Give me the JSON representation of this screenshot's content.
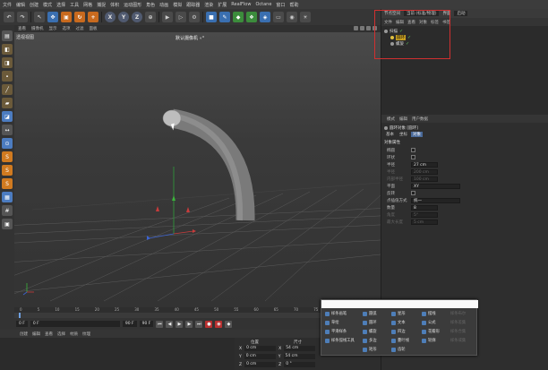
{
  "menubar": {
    "items": [
      "文件",
      "编辑",
      "创建",
      "模式",
      "选择",
      "工具",
      "网格",
      "捕捉",
      "体积",
      "运动图形",
      "角色",
      "动画",
      "模拟",
      "跟踪器",
      "渲染",
      "扩展",
      "RealFlow",
      "Octane",
      "窗口",
      "帮助"
    ],
    "interface_label": "界面",
    "interface_value": "启动",
    "node_space_label": "节点空间",
    "node_space_value": "当前 (标准/物理)"
  },
  "toolbar": {
    "icons": [
      "undo-icon",
      "redo-icon",
      "select-icon",
      "move-icon",
      "scale-icon",
      "rotate-icon",
      "add-icon",
      "x-axis-icon",
      "y-axis-icon",
      "z-axis-icon",
      "coord-icon",
      "render-view-icon",
      "render-icon",
      "render-settings-icon",
      "cube-icon",
      "pen-icon",
      "subdivide-icon",
      "array-icon",
      "deformer-icon",
      "floor-icon",
      "camera-icon",
      "light-icon"
    ],
    "axis_labels": [
      "X",
      "Y",
      "Z"
    ]
  },
  "left_tools": [
    "make-editable-icon",
    "model-icon",
    "texture-icon",
    "point-icon",
    "edge-icon",
    "polygon-icon",
    "uv-icon",
    "enable-axis-icon",
    "snap-icon",
    "s-icon-1",
    "s-icon-2",
    "s-icon-3",
    "workplane-icon",
    "grid-icon",
    "lock-icon"
  ],
  "viewport": {
    "menu": [
      "查看",
      "摄像机",
      "显示",
      "选项",
      "过滤",
      "面板"
    ],
    "title": "透视视图",
    "camera": "默认摄像机 ∘°"
  },
  "object_manager": {
    "menu": [
      "文件",
      "编辑",
      "查看",
      "对象",
      "标签",
      "书签"
    ],
    "objects": [
      {
        "name": "扫描",
        "indent": 0,
        "selected": false
      },
      {
        "name": "圆环",
        "indent": 1,
        "selected": true
      },
      {
        "name": "螺旋",
        "indent": 1,
        "selected": false
      }
    ]
  },
  "attributes": {
    "menu": [
      "模式",
      "编辑",
      "用户数据"
    ],
    "title": "圆环对象 [圆环]",
    "tabs": [
      "基本",
      "坐标",
      "对象"
    ],
    "active_tab": "对象",
    "section": "对象属性",
    "rows": [
      {
        "label": "椭圆",
        "type": "check",
        "value": "",
        "dim": false
      },
      {
        "label": "环状",
        "type": "check",
        "value": "",
        "dim": false
      },
      {
        "label": "半径",
        "type": "field",
        "value": "27 cm",
        "dim": false
      },
      {
        "label": "半径",
        "type": "field",
        "value": "200 cm",
        "dim": true
      },
      {
        "label": "内部半径",
        "type": "field",
        "value": "100 cm",
        "dim": true
      },
      {
        "label": "平面",
        "type": "select",
        "value": "XY",
        "dim": false
      },
      {
        "label": "反转",
        "type": "check",
        "value": "",
        "dim": false
      },
      {
        "label": "点插值方式",
        "type": "select",
        "value": "统一",
        "dim": false
      },
      {
        "label": "数量",
        "type": "field",
        "value": "8",
        "dim": false
      },
      {
        "label": "角度",
        "type": "field",
        "value": "5°",
        "dim": true
      },
      {
        "label": "最大长度",
        "type": "field",
        "value": "5 cm",
        "dim": true
      }
    ]
  },
  "timeline": {
    "ticks": [
      "0",
      "5",
      "10",
      "15",
      "20",
      "25",
      "30",
      "35",
      "40",
      "45",
      "50",
      "55",
      "60",
      "65",
      "70",
      "75",
      "80",
      "85",
      "90"
    ],
    "frame_start": "0 F",
    "frame_current": "0 F",
    "frame_end": "90 F",
    "frame_end2": "90 F"
  },
  "material_bar": [
    "创建",
    "编辑",
    "查看",
    "选择",
    "材质",
    "纹理"
  ],
  "coordinates": {
    "head_position": "位置",
    "head_size": "尺寸",
    "rows": [
      {
        "axis": "X",
        "pos": "0 cm",
        "size_axis": "X",
        "size": "54 cm"
      },
      {
        "axis": "Y",
        "pos": "0 cm",
        "size_axis": "Y",
        "size": "54 cm"
      },
      {
        "axis": "Z",
        "pos": "0 cm",
        "size_axis": "Z",
        "size": "0 °"
      }
    ]
  },
  "popup": {
    "col1": [
      {
        "label": "样条画笔",
        "dim": false
      },
      {
        "label": "草绘",
        "dim": false
      },
      {
        "label": "平滑样条",
        "dim": false
      },
      {
        "label": "样条弧线工具",
        "dim": false
      }
    ],
    "col2": [
      {
        "label": "圆弧",
        "dim": false
      },
      {
        "label": "圆环",
        "dim": false
      },
      {
        "label": "螺旋",
        "dim": false
      },
      {
        "label": "多边",
        "dim": false
      },
      {
        "label": "矩形",
        "dim": false
      }
    ],
    "col3": [
      {
        "label": "星形",
        "dim": false
      },
      {
        "label": "文本",
        "dim": false
      },
      {
        "label": "四边",
        "dim": false
      },
      {
        "label": "蔓叶线",
        "dim": false
      },
      {
        "label": "齿轮",
        "dim": false
      }
    ],
    "col4": [
      {
        "label": "摆线",
        "dim": false
      },
      {
        "label": "公式",
        "dim": false
      },
      {
        "label": "花瓣形",
        "dim": false
      },
      {
        "label": "轮廓",
        "dim": false
      }
    ],
    "col5": [
      {
        "label": "样条布尔",
        "dim": true
      },
      {
        "label": "样条差集",
        "dim": true
      },
      {
        "label": "样条合集",
        "dim": true
      },
      {
        "label": "样条或集",
        "dim": true
      }
    ]
  },
  "colors": {
    "accent": "#4a6a9a",
    "highlight_box": "#d03030",
    "x_axis": "#c83c3c",
    "y_axis": "#3cb43c",
    "z_axis": "#3c64d2"
  }
}
